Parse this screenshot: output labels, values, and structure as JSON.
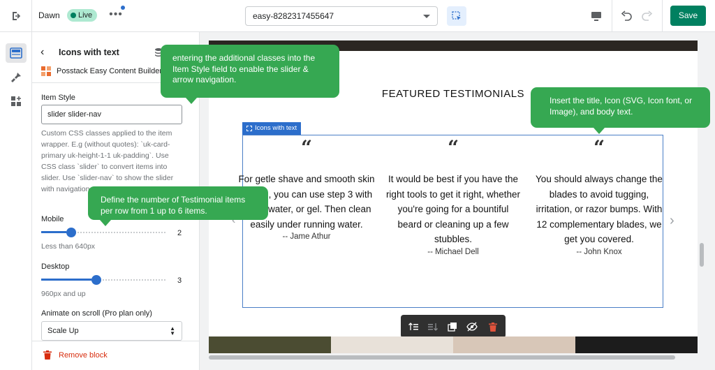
{
  "topbar": {
    "theme_name": "Dawn",
    "live_badge": "Live",
    "more_label": "•••",
    "template_value": "easy-8282317455647",
    "save_label": "Save"
  },
  "panel": {
    "back_icon": "‹",
    "title": "Icons with text",
    "app_name": "Posstack Easy Content Builder",
    "item_style_label": "Item Style",
    "item_style_value": "slider slider-nav",
    "help_text": "Custom CSS classes applied to the item wrapper. E.g (without quotes): `uk-card-primary uk-height-1-1 uk-padding`. Use CSS class `slider` to convert items into slider. Use `slider-nav` to show the slider with navigation arrows.",
    "mobile_label": "Mobile",
    "mobile_value": "2",
    "mobile_fraction": 0.2,
    "mobile_help": "Less than 640px",
    "desktop_label": "Desktop",
    "desktop_value": "3",
    "desktop_fraction": 0.4,
    "desktop_help": "960px and up",
    "animate_label": "Animate on scroll (Pro plan only)",
    "animate_value": "Scale Up",
    "remove_label": "Remove block"
  },
  "preview": {
    "heading": "FEATURED TESTIMONIALS",
    "block_tag": "Icons with text",
    "testimonials": [
      {
        "quote": "“",
        "body": "For getle shave and smooth skin feeling, you can use step 3 with foam, water, or gel. Then clean easily under running water.",
        "author": "-- Jame Athur"
      },
      {
        "quote": "“",
        "body": "It would be best if you have the right tools to get it right, whether you're going for a bountiful beard or cleaning up a few stubbles.",
        "author": "-- Michael Dell"
      },
      {
        "quote": "“",
        "body": "You should always change the blades to avoid tugging, irritation, or razor bumps. With 12 complementary blades, we get you covered.",
        "author": "-- John Knox"
      }
    ]
  },
  "callouts": {
    "c1": "entering the additional classes into the Item Style field to enable the slider & arrow navigation.",
    "c2": "Insert the title, Icon (SVG, Icon font, or Image), and body text.",
    "c3": "Define the number of Testimonial items per row from 1 up to 6 items."
  },
  "colors": {
    "accent": "#2c6ecb",
    "save": "#008060",
    "callout": "#36a852",
    "danger": "#d72c0d"
  },
  "icons": [
    "exit-icon",
    "inspector-icon",
    "desktop-icon",
    "undo-icon",
    "redo-icon",
    "sections-icon",
    "theme-settings-icon",
    "app-blocks-icon",
    "database-icon",
    "trash-icon"
  ]
}
